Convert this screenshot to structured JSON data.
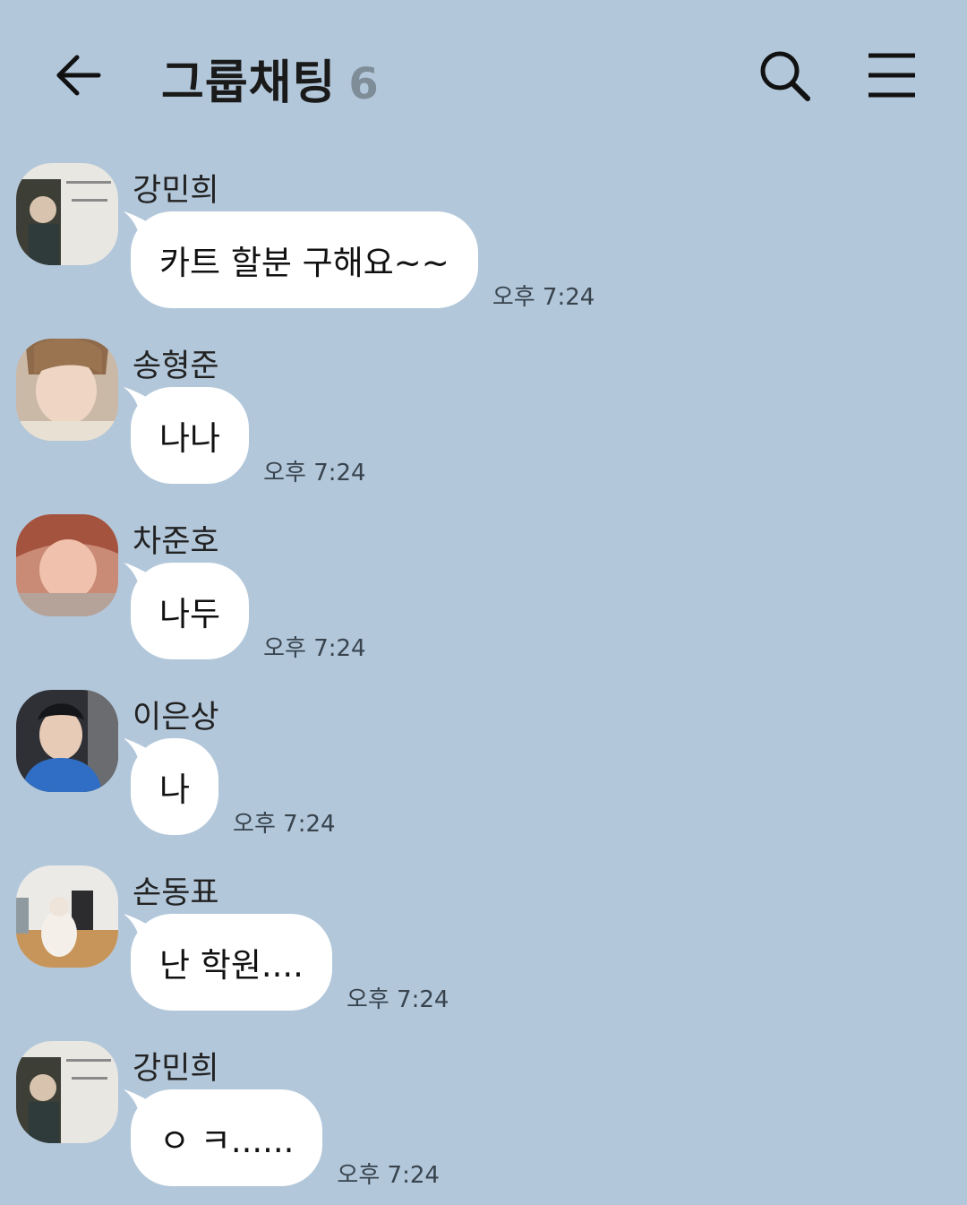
{
  "header": {
    "title": "그룹채팅",
    "member_count": "6"
  },
  "messages": [
    {
      "sender": "강민희",
      "text": "카트 할분 구해요~~",
      "time": "오후 7:24",
      "avatar": "avatar-kang-minhee"
    },
    {
      "sender": "송형준",
      "text": "나나",
      "time": "오후 7:24",
      "avatar": "avatar-song-hyeongjun"
    },
    {
      "sender": "차준호",
      "text": "나두",
      "time": "오후 7:24",
      "avatar": "avatar-cha-junho"
    },
    {
      "sender": "이은상",
      "text": "나",
      "time": "오후 7:24",
      "avatar": "avatar-lee-eunsang"
    },
    {
      "sender": "손동표",
      "text": "난 학원....",
      "time": "오후 7:24",
      "avatar": "avatar-son-dongpyo"
    },
    {
      "sender": "강민희",
      "text": "ㅇ ㅋ......",
      "time": "오후 7:24",
      "avatar": "avatar-kang-minhee"
    }
  ],
  "colors": {
    "background": "#b2c7da",
    "bubble": "#ffffff",
    "member_count": "#7f8d99"
  }
}
